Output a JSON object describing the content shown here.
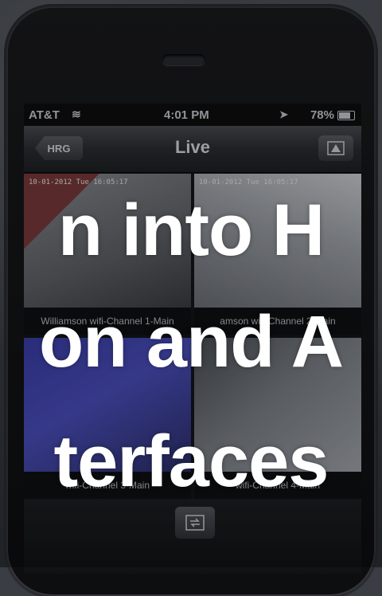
{
  "status_bar": {
    "carrier": "AT&T",
    "time": "4:01 PM",
    "battery": "78%"
  },
  "nav": {
    "back_label": "HRG",
    "title": "Live"
  },
  "cameras": [
    {
      "timestamp": "10-01-2012 Tue 16:05:17",
      "caption": "Williamson wifi-Channel 1-Main"
    },
    {
      "timestamp": "10-01-2012 Tue 16:05:17",
      "caption": "amson wifi-Channel 2-Main"
    },
    {
      "timestamp": "",
      "caption": "wifi-Channel 3-Main"
    },
    {
      "timestamp": "",
      "caption": "wifi-Channel 4-Main"
    }
  ],
  "overlay": {
    "line1": "n into H",
    "line2": "on and A",
    "line3": "terfaces"
  }
}
